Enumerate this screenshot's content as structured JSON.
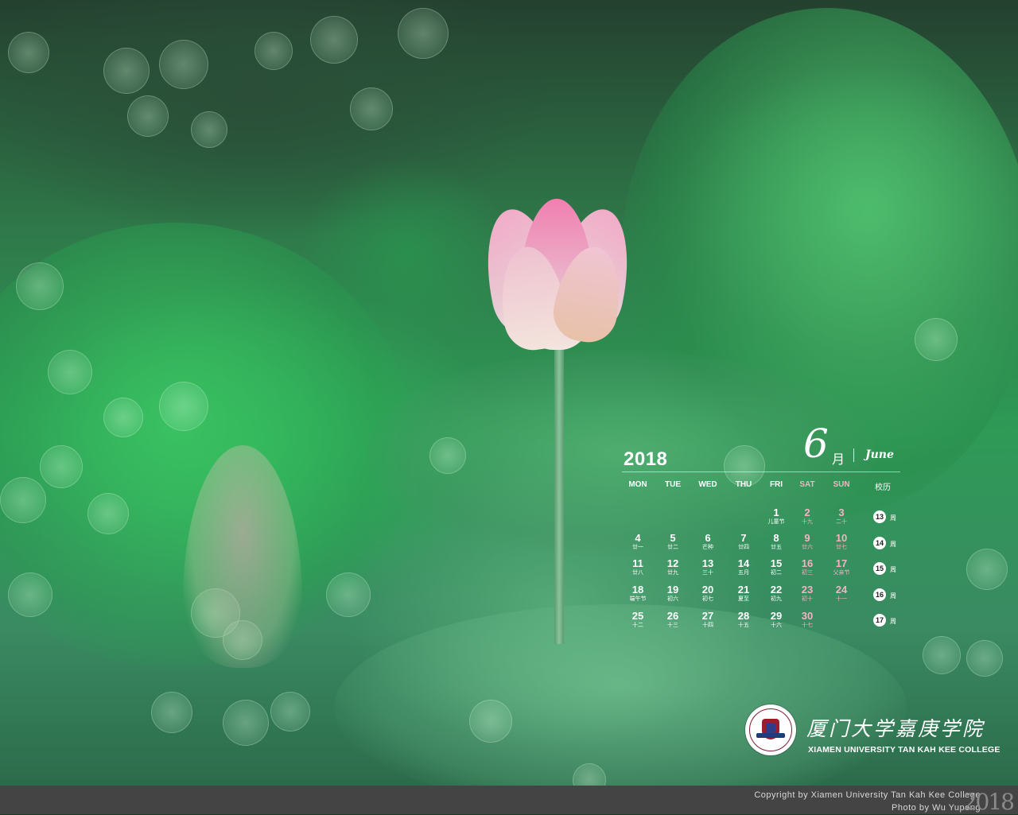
{
  "calendar": {
    "year": "2018",
    "month_number": "6",
    "month_cn": "月",
    "month_en": "June",
    "headers": [
      "MON",
      "TUE",
      "WED",
      "THU",
      "FRI",
      "SAT",
      "SUN"
    ],
    "term_header": "校历",
    "days": [
      {
        "d": "1",
        "l": "儿童节"
      },
      {
        "d": "2",
        "l": "十九"
      },
      {
        "d": "3",
        "l": "二十"
      },
      {
        "d": "4",
        "l": "廿一"
      },
      {
        "d": "5",
        "l": "廿二"
      },
      {
        "d": "6",
        "l": "芒种"
      },
      {
        "d": "7",
        "l": "廿四"
      },
      {
        "d": "8",
        "l": "廿五"
      },
      {
        "d": "9",
        "l": "廿六"
      },
      {
        "d": "10",
        "l": "廿七"
      },
      {
        "d": "11",
        "l": "廿八"
      },
      {
        "d": "12",
        "l": "廿九"
      },
      {
        "d": "13",
        "l": "三十"
      },
      {
        "d": "14",
        "l": "五月"
      },
      {
        "d": "15",
        "l": "初二"
      },
      {
        "d": "16",
        "l": "初三"
      },
      {
        "d": "17",
        "l": "父亲节"
      },
      {
        "d": "18",
        "l": "端午节"
      },
      {
        "d": "19",
        "l": "初六"
      },
      {
        "d": "20",
        "l": "初七"
      },
      {
        "d": "21",
        "l": "夏至"
      },
      {
        "d": "22",
        "l": "初九"
      },
      {
        "d": "23",
        "l": "初十"
      },
      {
        "d": "24",
        "l": "十一"
      },
      {
        "d": "25",
        "l": "十二"
      },
      {
        "d": "26",
        "l": "十三"
      },
      {
        "d": "27",
        "l": "十四"
      },
      {
        "d": "28",
        "l": "十五"
      },
      {
        "d": "29",
        "l": "十六"
      },
      {
        "d": "30",
        "l": "十七"
      }
    ],
    "weeks": [
      "13",
      "14",
      "15",
      "16",
      "17"
    ],
    "week_suffix": "周"
  },
  "college": {
    "name_cn": "厦门大学嘉庚学院",
    "name_en": "XIAMEN UNIVERSITY TAN KAH KEE COLLEGE"
  },
  "footer": {
    "copyright": "Copyright  by  Xiamen  University  Tan  Kah  Kee  College",
    "photo": "Photo  by  Wu  Yupeng",
    "year": "2018"
  },
  "colors": {
    "weekend": "#f6b2c3",
    "footer_bg": "#444444"
  },
  "icons": {
    "emblem": "college-emblem-icon"
  }
}
